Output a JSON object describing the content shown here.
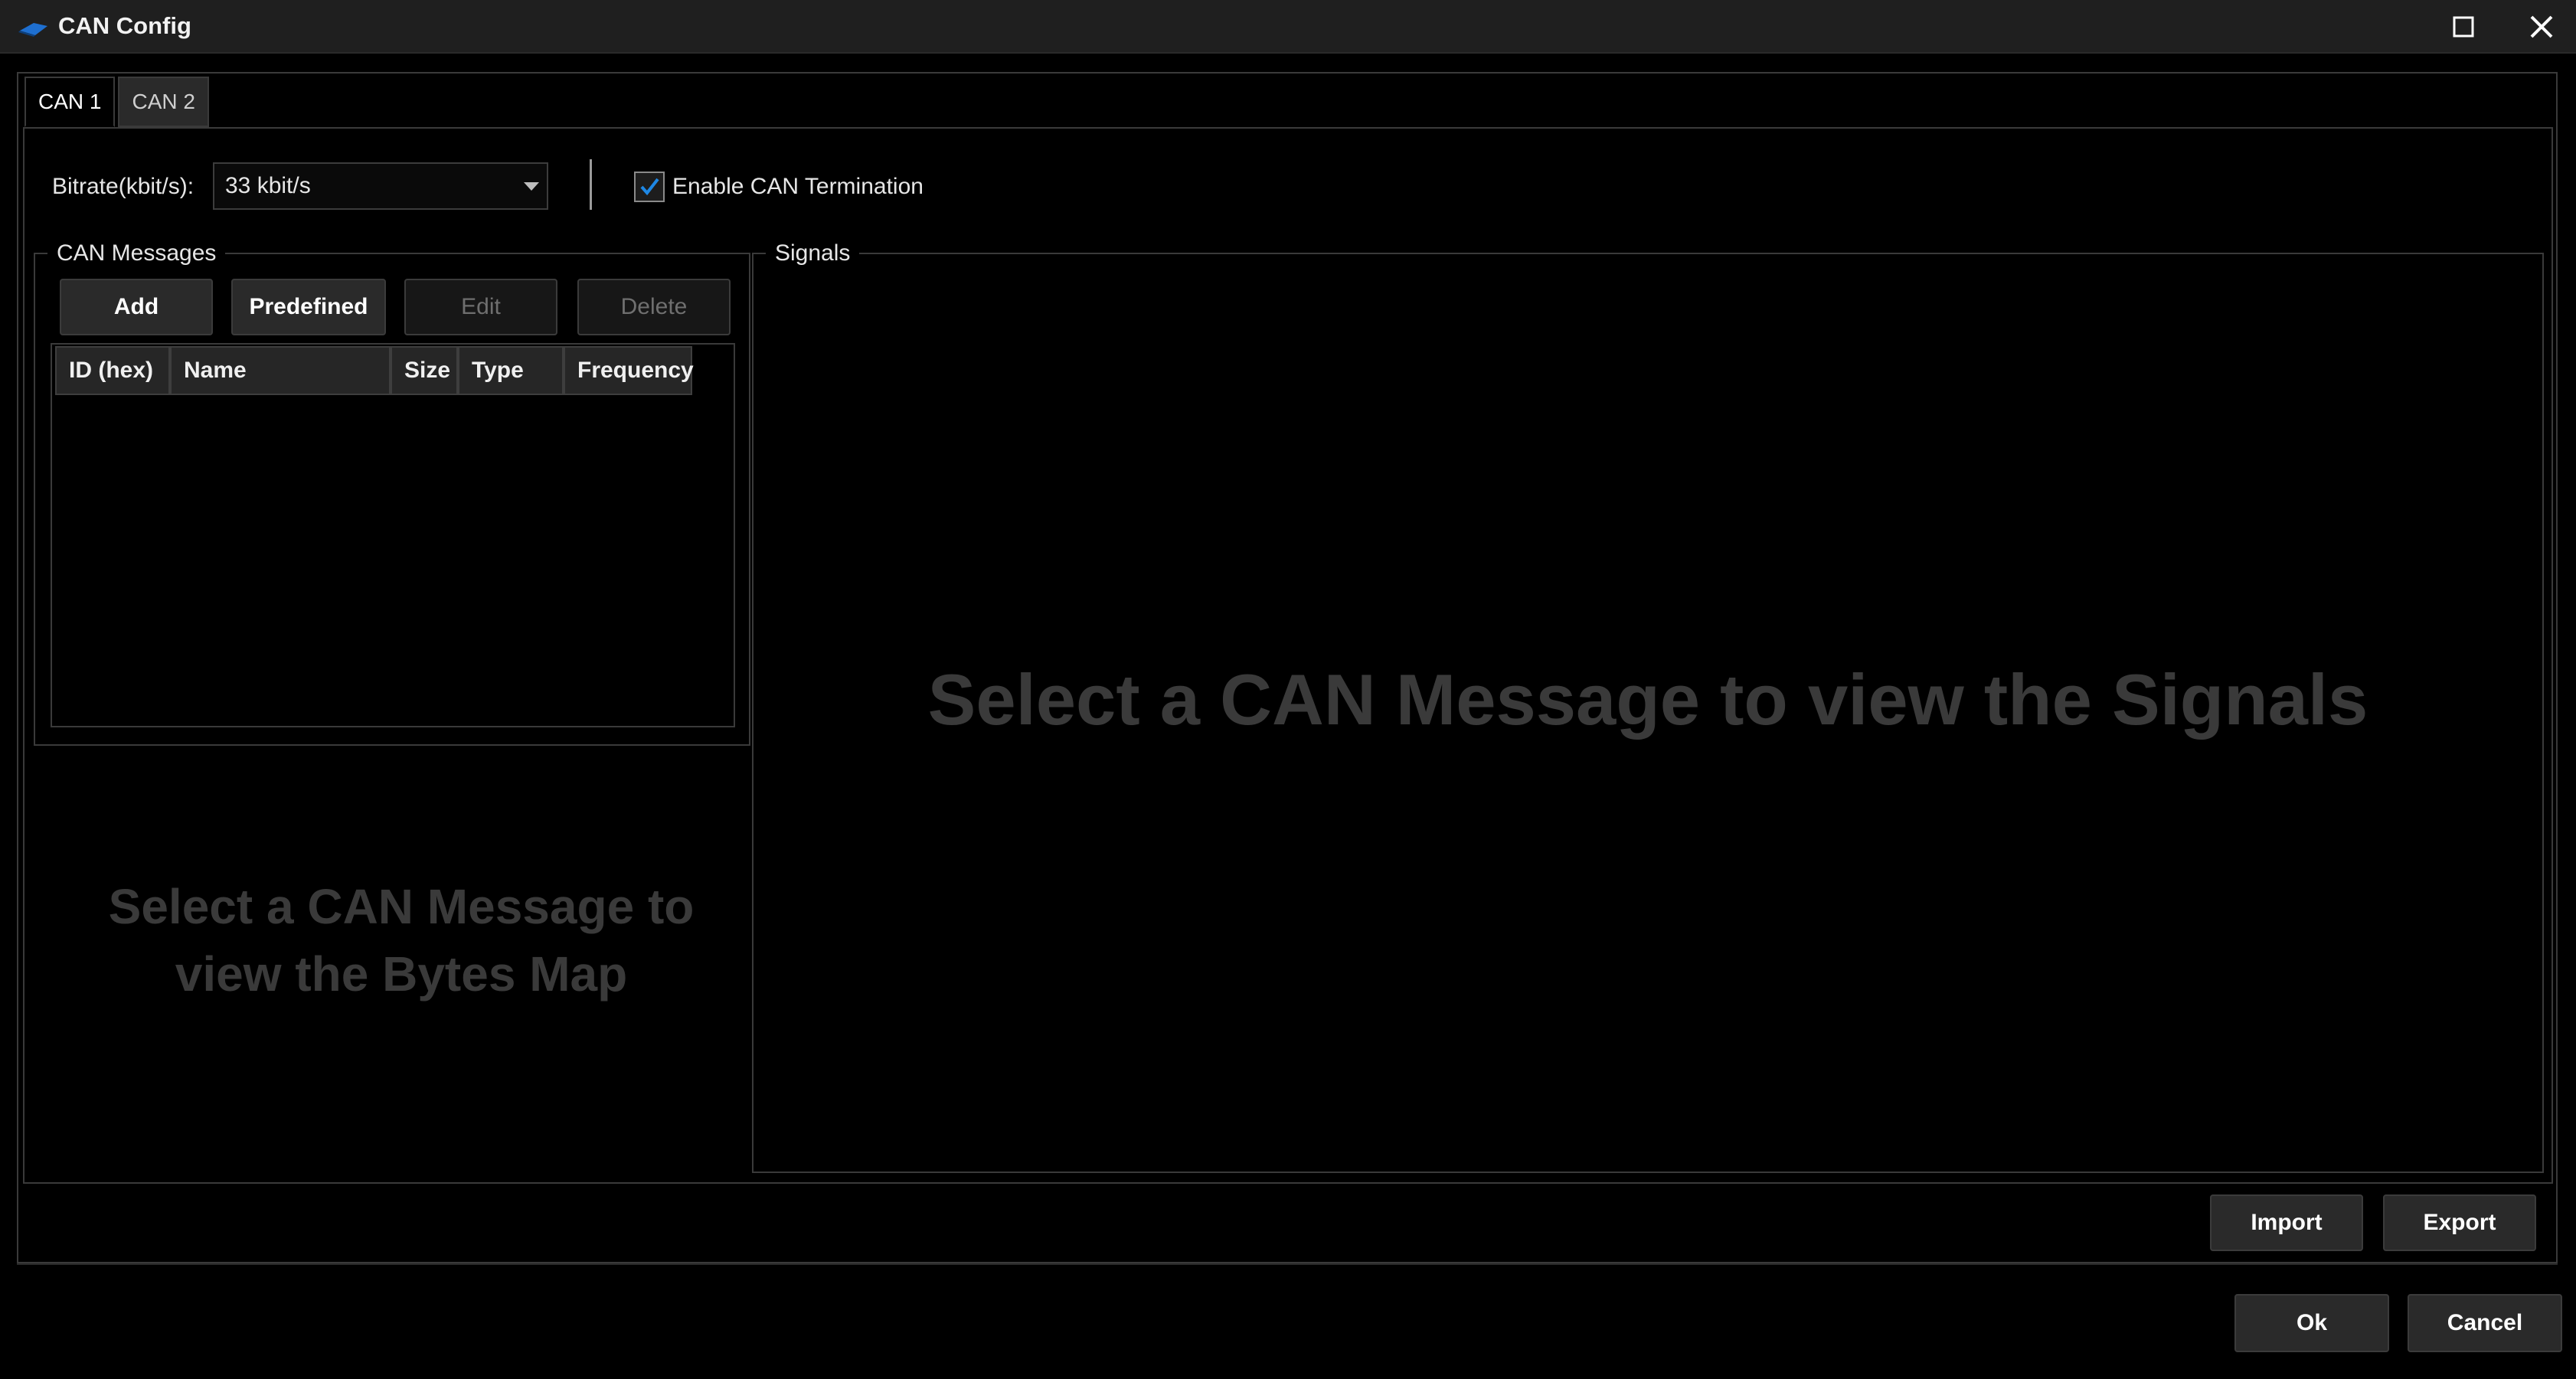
{
  "window": {
    "title": "CAN Config",
    "icon": "app-logo-icon",
    "controls": [
      "maximize-icon",
      "close-icon"
    ]
  },
  "tabs": [
    {
      "label": "CAN 1",
      "active": true
    },
    {
      "label": "CAN 2",
      "active": false
    }
  ],
  "bitrate": {
    "label": "Bitrate(kbit/s):",
    "value": "33 kbit/s"
  },
  "termination": {
    "label": "Enable CAN Termination",
    "checked": true
  },
  "can_messages": {
    "title": "CAN Messages",
    "buttons": {
      "add": "Add",
      "predefined": "Predefined",
      "edit": "Edit",
      "delete": "Delete"
    },
    "columns": [
      "ID (hex)",
      "Name",
      "Size",
      "Type",
      "Frequency"
    ],
    "rows": []
  },
  "bytes_map_placeholder": {
    "line1": "Select a CAN Message to",
    "line2": "view the Bytes Map"
  },
  "signals": {
    "title": "Signals",
    "placeholder": "Select a CAN Message to view the Signals"
  },
  "footer": {
    "import": "Import",
    "export": "Export",
    "ok": "Ok",
    "cancel": "Cancel"
  },
  "colors": {
    "background": "#000000",
    "titlebar": "#1f1f1f",
    "accent": "#1e88e5",
    "border": "#3a3a3a",
    "placeholder_text": "#3a3a3a"
  }
}
